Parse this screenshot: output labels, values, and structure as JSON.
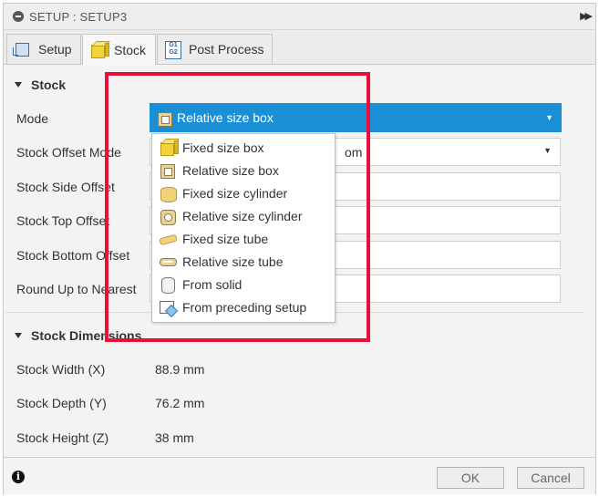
{
  "window": {
    "title": "SETUP : SETUP3",
    "title_icon": "minus-circle-icon",
    "expand_icon": "double-chevron-right-icon"
  },
  "tabs": [
    {
      "label": "Setup",
      "icon": "setup-icon",
      "active": false
    },
    {
      "label": "Stock",
      "icon": "stock-cube-icon",
      "active": true
    },
    {
      "label": "Post Process",
      "icon": "post-process-icon",
      "post_icon_text": "G1 G2",
      "active": false
    }
  ],
  "stock_section": {
    "title": "Stock",
    "rows": [
      {
        "label": "Mode",
        "value": "Relative size box"
      },
      {
        "label": "Stock Offset Mode",
        "value_visible": "om"
      },
      {
        "label": "Stock Side Offset"
      },
      {
        "label": "Stock Top Offset"
      },
      {
        "label": "Stock Bottom Offset"
      },
      {
        "label": "Round Up to Nearest"
      }
    ]
  },
  "mode_dropdown": {
    "options": [
      {
        "label": "Fixed size box",
        "icon": "fixed-size-box-icon"
      },
      {
        "label": "Relative size box",
        "icon": "relative-size-box-icon"
      },
      {
        "label": "Fixed size cylinder",
        "icon": "fixed-size-cylinder-icon"
      },
      {
        "label": "Relative size cylinder",
        "icon": "relative-size-cylinder-icon"
      },
      {
        "label": "Fixed size tube",
        "icon": "fixed-size-tube-icon"
      },
      {
        "label": "Relative size tube",
        "icon": "relative-size-tube-icon"
      },
      {
        "label": "From solid",
        "icon": "from-solid-icon"
      },
      {
        "label": "From preceding setup",
        "icon": "from-preceding-setup-icon"
      }
    ]
  },
  "dimensions_section": {
    "title": "Stock Dimensions",
    "rows": [
      {
        "label": "Stock Width (X)",
        "value": "88.9 mm"
      },
      {
        "label": "Stock Depth (Y)",
        "value": "76.2 mm"
      },
      {
        "label": "Stock Height (Z)",
        "value": "38 mm"
      }
    ]
  },
  "footer": {
    "info_icon": "info-icon",
    "ok_label": "OK",
    "cancel_label": "Cancel"
  },
  "colors": {
    "selected_blue": "#1a8fd6",
    "highlight_red": "#e8103a"
  }
}
